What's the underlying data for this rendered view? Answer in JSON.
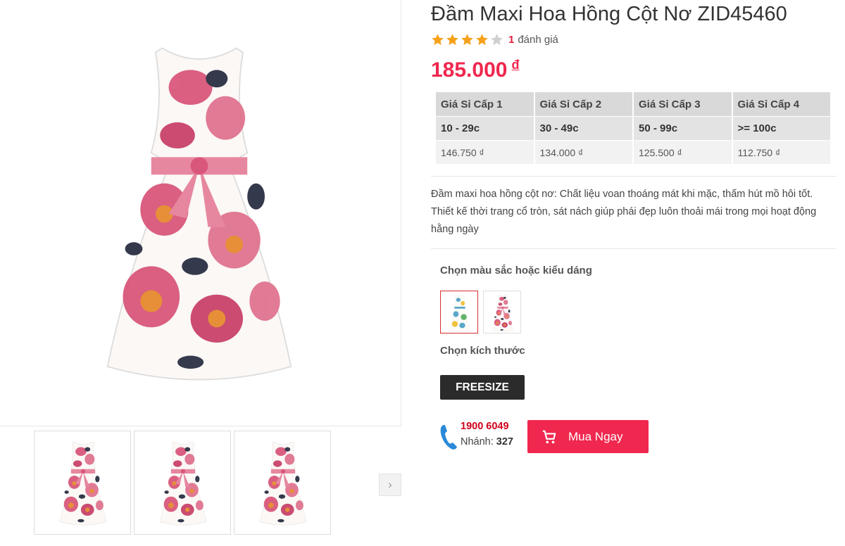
{
  "product": {
    "title": "Đầm Maxi Hoa Hồng Cột Nơ ZID45460",
    "rating": {
      "stars": 4,
      "max": 5,
      "count": "1",
      "word": "đánh giá"
    },
    "price": {
      "amount": "185.000",
      "currency": "đ"
    },
    "description": "Đầm maxi hoa hồng cột nơ: Chất liệu voan thoáng mát khi mặc, thấm hút mồ hôi tốt. Thiết kế thời trang cổ tròn, sát nách giúp phái đẹp luôn thoải mái trong mọi hoạt động hằng ngày"
  },
  "wholesale": {
    "headers": [
      "Giá Sỉ Cấp 1",
      "Giá Sỉ Cấp 2",
      "Giá Sỉ Cấp 3",
      "Giá Sỉ Cấp 4"
    ],
    "quantities": [
      "10 - 29c",
      "30 - 49c",
      "50 - 99c",
      ">= 100c"
    ],
    "prices": [
      "146.750 ₫",
      "134.000 ₫",
      "125.500 ₫",
      "112.750 ₫"
    ]
  },
  "options": {
    "color_label": "Chọn màu sắc hoặc kiểu dáng",
    "size_label": "Chọn kích thước",
    "size_value": "FREESIZE",
    "swatches": [
      "blue-floral-dress",
      "pink-floral-dress"
    ]
  },
  "contact": {
    "hotline": "1900 6049",
    "ext_label": "Nhánh:",
    "ext_value": "327"
  },
  "actions": {
    "buy_label": "Mua Ngay",
    "next_icon": "›"
  },
  "icons": [
    "star-icon",
    "phone-icon",
    "cart-icon",
    "chevron-right-icon"
  ],
  "colors": {
    "accent": "#f0274e",
    "star": "#f7a11a",
    "star_off": "#cfcfcf",
    "dark_button": "#2b2b2b",
    "hotline": "#d0021b",
    "phone": "#2a8ad8"
  }
}
